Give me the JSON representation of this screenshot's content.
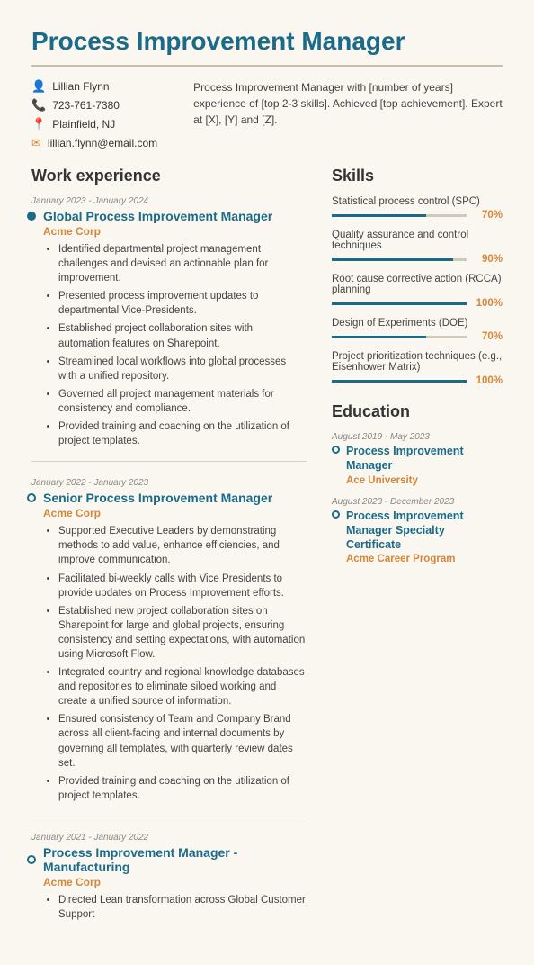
{
  "header": {
    "title": "Process Improvement Manager",
    "summary": "Process Improvement Manager with [number of years] experience of [top 2-3 skills]. Achieved [top achievement]. Expert at [X], [Y] and [Z].",
    "contact": {
      "name": "Lillian Flynn",
      "phone": "723-761-7380",
      "location": "Plainfield, NJ",
      "email": "lillian.flynn@email.com"
    }
  },
  "sections": {
    "work_experience_label": "Work experience",
    "skills_label": "Skills",
    "education_label": "Education"
  },
  "jobs": [
    {
      "date": "January 2023 - January 2024",
      "title": "Global Process Improvement Manager",
      "company": "Acme Corp",
      "filled": true,
      "bullets": [
        "Identified departmental project management challenges and devised an actionable plan for improvement.",
        "Presented process improvement updates to departmental Vice-Presidents.",
        "Established project collaboration sites with automation features on Sharepoint.",
        "Streamlined local workflows into global processes with a unified repository.",
        "Governed all project management materials for consistency and compliance.",
        "Provided training and coaching on the utilization of project templates."
      ]
    },
    {
      "date": "January 2022 - January 2023",
      "title": "Senior Process Improvement Manager",
      "company": "Acme Corp",
      "filled": false,
      "bullets": [
        "Supported Executive Leaders by demonstrating methods to add value, enhance efficiencies, and improve communication.",
        "Facilitated bi-weekly calls with Vice Presidents to provide updates on Process Improvement efforts.",
        "Established new project collaboration sites on Sharepoint for large and global projects, ensuring consistency and setting expectations, with automation using Microsoft Flow.",
        "Integrated country and regional knowledge databases and repositories to eliminate siloed working and create a unified source of information.",
        "Ensured consistency of Team and Company Brand across all client-facing and internal documents by governing all templates, with quarterly review dates set.",
        "Provided training and coaching on the utilization of project templates."
      ]
    },
    {
      "date": "January 2021 - January 2022",
      "title": "Process Improvement Manager - Manufacturing",
      "company": "Acme Corp",
      "filled": false,
      "bullets": [
        "Directed Lean transformation across Global Customer Support"
      ]
    }
  ],
  "skills": [
    {
      "label": "Statistical process control (SPC)",
      "pct": 70
    },
    {
      "label": "Quality assurance and control techniques",
      "pct": 90
    },
    {
      "label": "Root cause corrective action (RCCA) planning",
      "pct": 100
    },
    {
      "label": "Design of Experiments (DOE)",
      "pct": 70
    },
    {
      "label": "Project prioritization techniques (e.g., Eisenhower Matrix)",
      "pct": 100
    }
  ],
  "education": [
    {
      "date": "August 2019 - May 2023",
      "title": "Process Improvement Manager",
      "company": "Ace University",
      "filled": true
    },
    {
      "date": "August 2023 - December 2023",
      "title": "Process Improvement Manager Specialty Certificate",
      "company": "Acme Career Program",
      "filled": false
    }
  ]
}
